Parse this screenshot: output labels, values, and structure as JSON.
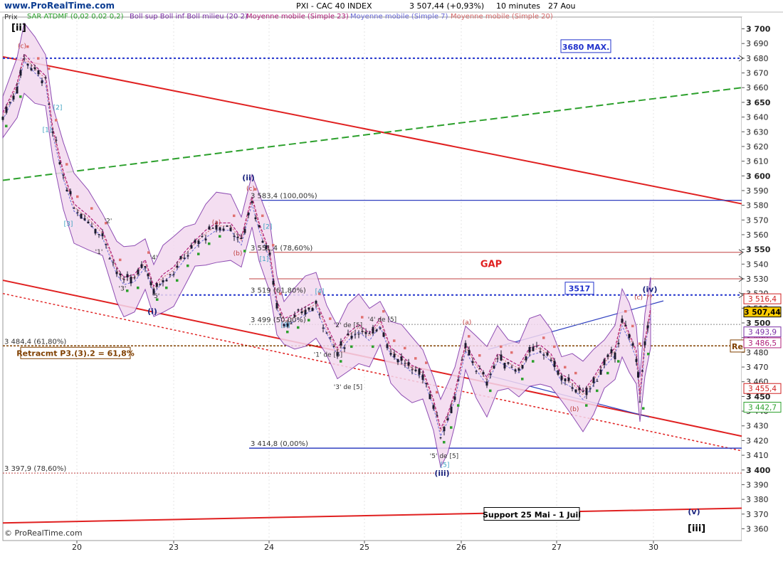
{
  "site": "www.ProRealTime.com",
  "footer": "© ProRealTime.com",
  "header": {
    "symbol": "PXI - CAC 40 INDEX",
    "price": "3 507,44 (+0,93%)",
    "interval": "10 minutes",
    "date": "27 Aou"
  },
  "prix_label": "Prix",
  "legend": [
    {
      "text": "SAR ATDMF (0,02 0,02 0,2)",
      "color": "#2ca02c"
    },
    {
      "text": "Boll sup Boll inf Boll milieu (20 2)",
      "color": "#7b2fa6"
    },
    {
      "text": "Moyenne mobile (Simple 23)",
      "color": "#b0207a"
    },
    {
      "text": "Moyenne mobile (Simple 7)",
      "color": "#6b6bd6"
    },
    {
      "text": "Moyenne mobile (Simple 20)",
      "color": "#d46a6a"
    }
  ],
  "chart_data": {
    "type": "candlestick",
    "ylim": [
      3352,
      3708
    ],
    "x_ticks": [
      "20",
      "23",
      "24",
      "25",
      "26",
      "27",
      "30"
    ],
    "y_ticks": [
      3360,
      3370,
      3380,
      3390,
      3400,
      3410,
      3420,
      3430,
      3440,
      3450,
      3460,
      3470,
      3480,
      3490,
      3500,
      3510,
      3520,
      3530,
      3540,
      3550,
      3560,
      3570,
      3580,
      3590,
      3600,
      3610,
      3620,
      3630,
      3640,
      3650,
      3660,
      3670,
      3680,
      3690,
      3700
    ],
    "price_path": [
      [
        0,
        3640
      ],
      [
        20,
        3660
      ],
      [
        30,
        3680
      ],
      [
        45,
        3672
      ],
      [
        60,
        3665
      ],
      [
        70,
        3630
      ],
      [
        85,
        3600
      ],
      [
        100,
        3578
      ],
      [
        120,
        3570
      ],
      [
        140,
        3560
      ],
      [
        160,
        3535
      ],
      [
        170,
        3528
      ],
      [
        185,
        3530
      ],
      [
        200,
        3540
      ],
      [
        212,
        3522
      ],
      [
        225,
        3530
      ],
      [
        240,
        3535
      ],
      [
        255,
        3545
      ],
      [
        270,
        3553
      ],
      [
        285,
        3560
      ],
      [
        300,
        3565
      ],
      [
        320,
        3565
      ],
      [
        335,
        3555
      ],
      [
        350,
        3583
      ],
      [
        360,
        3565
      ],
      [
        375,
        3545
      ],
      [
        385,
        3512
      ],
      [
        395,
        3500
      ],
      [
        410,
        3503
      ],
      [
        425,
        3508
      ],
      [
        440,
        3512
      ],
      [
        455,
        3495
      ],
      [
        470,
        3480
      ],
      [
        485,
        3490
      ],
      [
        500,
        3496
      ],
      [
        515,
        3490
      ],
      [
        530,
        3500
      ],
      [
        545,
        3480
      ],
      [
        560,
        3475
      ],
      [
        575,
        3468
      ],
      [
        590,
        3465
      ],
      [
        605,
        3445
      ],
      [
        615,
        3425
      ],
      [
        625,
        3435
      ],
      [
        635,
        3450
      ],
      [
        650,
        3483
      ],
      [
        665,
        3470
      ],
      [
        680,
        3460
      ],
      [
        695,
        3476
      ],
      [
        710,
        3472
      ],
      [
        725,
        3468
      ],
      [
        740,
        3480
      ],
      [
        755,
        3482
      ],
      [
        770,
        3476
      ],
      [
        785,
        3462
      ],
      [
        800,
        3458
      ],
      [
        815,
        3450
      ],
      [
        830,
        3460
      ],
      [
        845,
        3472
      ],
      [
        860,
        3480
      ],
      [
        870,
        3500
      ],
      [
        880,
        3490
      ],
      [
        890,
        3478
      ],
      [
        895,
        3448
      ],
      [
        902,
        3485
      ],
      [
        910,
        3507
      ]
    ],
    "annotations_h": [
      {
        "label": "3680 MAX.",
        "value": 3680,
        "style": "dotted",
        "color": "#2233cc"
      },
      {
        "label": "3 583,4 (100,00%)",
        "value": 3583.4,
        "color": "#3040c0"
      },
      {
        "label": "3 551,4 (78,60%)",
        "value": 3548,
        "color": "#c04040"
      },
      {
        "label": "3 519 (61,80%)",
        "value": 3519,
        "color": "#3040c0"
      },
      {
        "label": "3 499 (50,00%)",
        "value": 3499,
        "color": "#888888"
      },
      {
        "label": "3 484,4 (61,80%)",
        "value": 3484.4,
        "color": "#804000"
      },
      {
        "label": "3 414,8 (0,00%)",
        "value": 3414.8,
        "color": "#3040c0"
      },
      {
        "label": "3 397,9 (78,60%)",
        "value": 3397.9,
        "color": "#c04040"
      }
    ],
    "price_tags": [
      {
        "value": "3 516,4",
        "level": 3516.4,
        "color": "#d02020",
        "bg": "#ffffff"
      },
      {
        "value": "3 507,44",
        "level": 3507.44,
        "color": "#000000",
        "bg": "#ffcc00"
      },
      {
        "value": "3 493,9",
        "level": 3493.9,
        "color": "#7b2fa6",
        "bg": "#ffffff"
      },
      {
        "value": "3 486,5",
        "level": 3486.5,
        "color": "#b0207a",
        "bg": "#ffffff"
      },
      {
        "value": "3 455,4",
        "level": 3455.4,
        "color": "#d02020",
        "bg": "#ffffff"
      },
      {
        "value": "3 442,7",
        "level": 3442.7,
        "color": "#2ca02c",
        "bg": "#ffffff"
      }
    ],
    "labels": {
      "gap": "GAP",
      "retracement": "Retracmt P3.(3).2 = 61,8%",
      "support": "Support 25 Mai - 1 Juil",
      "box_3517": "3517",
      "box_max": "3680 MAX.",
      "wave_ii": "[ii]",
      "wave_iii": "[iii]",
      "ii": "(ii)",
      "iii": "(iii)",
      "iv": "(iv)",
      "v": "(v)",
      "i": "(i)",
      "re": "Re"
    },
    "wave_marks": [
      {
        "text": "(c)",
        "color": "#c04040",
        "v": 3687,
        "x": 27
      },
      {
        "text": "[1]",
        "color": "#3aa0c0",
        "v": 3630,
        "x": 62
      },
      {
        "text": "[2]",
        "color": "#3aa0c0",
        "v": 3645,
        "x": 77
      },
      {
        "text": "[3]",
        "color": "#3aa0c0",
        "v": 3566,
        "x": 92
      },
      {
        "text": "'1'",
        "color": "#333",
        "v": 3547,
        "x": 135
      },
      {
        "text": "'2'",
        "color": "#333",
        "v": 3568,
        "x": 148
      },
      {
        "text": "'3'",
        "color": "#333",
        "v": 3522,
        "x": 168
      },
      {
        "text": "'4'",
        "color": "#333",
        "v": 3543,
        "x": 212
      },
      {
        "text": "'5'",
        "color": "#333",
        "v": 3517,
        "x": 215
      },
      {
        "text": "(a)",
        "color": "#c04040",
        "v": 3567,
        "x": 300
      },
      {
        "text": "(b)",
        "color": "#c04040",
        "v": 3546,
        "x": 330
      },
      {
        "text": "(c)",
        "color": "#c04040",
        "v": 3590,
        "x": 348
      },
      {
        "text": "[2]",
        "color": "#3aa0c0",
        "v": 3564,
        "x": 372
      },
      {
        "text": "[1]",
        "color": "#3aa0c0",
        "v": 3542,
        "x": 367
      },
      {
        "text": "[3]",
        "color": "#3aa0c0",
        "v": 3497,
        "x": 397
      },
      {
        "text": "[4]",
        "color": "#3aa0c0",
        "v": 3520,
        "x": 445
      },
      {
        "text": "'2' de [5]",
        "color": "#333",
        "v": 3497,
        "x": 485
      },
      {
        "text": "'4' de [5]",
        "color": "#333",
        "v": 3501,
        "x": 533
      },
      {
        "text": "'1' de [5]",
        "color": "#333",
        "v": 3477,
        "x": 457
      },
      {
        "text": "'3' de [5]",
        "color": "#333",
        "v": 3455,
        "x": 485
      },
      {
        "text": "(a)",
        "color": "#c04040",
        "v": 3499,
        "x": 652
      },
      {
        "text": "(b)",
        "color": "#c04040",
        "v": 3440,
        "x": 803
      },
      {
        "text": "(c)",
        "color": "#c04040",
        "v": 3516,
        "x": 893
      },
      {
        "text": "??",
        "color": "#c04040",
        "v": 3516,
        "x": 908
      },
      {
        "text": "'5' de [5]",
        "color": "#333",
        "v": 3408,
        "x": 620
      },
      {
        "text": "[5]",
        "color": "#3aa0c0",
        "v": 3402,
        "x": 621
      }
    ]
  }
}
